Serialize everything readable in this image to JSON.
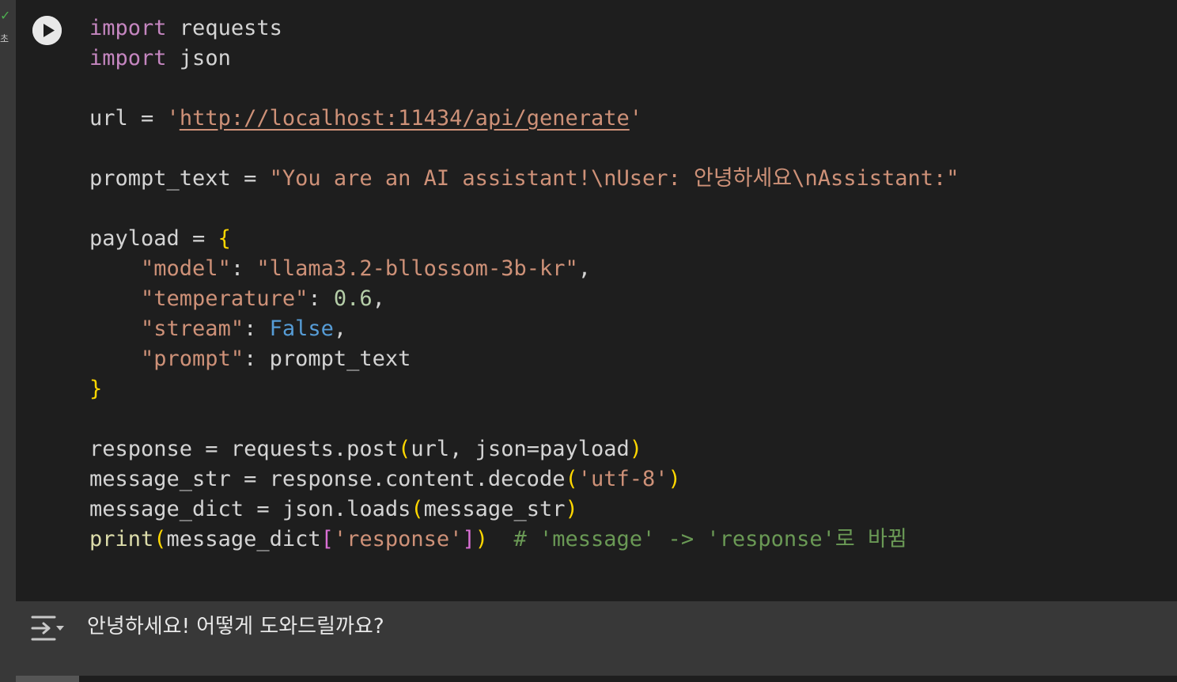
{
  "gutter": {
    "status_icon": "check-icon",
    "exec_time": "초"
  },
  "cell": {
    "run_icon": "play-icon",
    "accent_colors": {
      "keyword": "#c586c0",
      "string": "#ce9178",
      "number": "#b5cea8",
      "boolean": "#569cd6",
      "function": "#dcdcaa",
      "bracket_outer": "#ffd700",
      "bracket_inner": "#da70d6",
      "comment": "#6a9955"
    },
    "code": {
      "l1_kw": "import",
      "l1_rest": " requests",
      "l2_kw": "import",
      "l2_rest": " json",
      "l4_var": "url = ",
      "l4_q1": "'",
      "l4_url": "http://localhost:11434/api/generate",
      "l4_q2": "'",
      "l6_var": "prompt_text = ",
      "l6_str": "\"You are an AI assistant!\\nUser: 안녕하세요\\nAssistant:\"",
      "l8_var": "payload = ",
      "l8_brace": "{",
      "l9_indent": "    ",
      "l9_key": "\"model\"",
      "l9_colon": ": ",
      "l9_val": "\"llama3.2-bllossom-3b-kr\"",
      "l9_comma": ",",
      "l10_indent": "    ",
      "l10_key": "\"temperature\"",
      "l10_colon": ": ",
      "l10_val": "0.6",
      "l10_comma": ",",
      "l11_indent": "    ",
      "l11_key": "\"stream\"",
      "l11_colon": ": ",
      "l11_val": "False",
      "l11_comma": ",",
      "l12_indent": "    ",
      "l12_key": "\"prompt\"",
      "l12_colon": ": ",
      "l12_val": "prompt_text",
      "l13_brace": "}",
      "l15_a": "response = requests.post",
      "l15_p1": "(",
      "l15_b": "url, json=payload",
      "l15_p2": ")",
      "l16_a": "message_str = response.content.decode",
      "l16_p1": "(",
      "l16_str": "'utf-8'",
      "l16_p2": ")",
      "l17_a": "message_dict = json.loads",
      "l17_p1": "(",
      "l17_b": "message_str",
      "l17_p2": ")",
      "l18_fn": "print",
      "l18_p1": "(",
      "l18_b": "message_dict",
      "l18_sb1": "[",
      "l18_str": "'response'",
      "l18_sb2": "]",
      "l18_p2": ")",
      "l18_comment": "  # 'message' -> 'response'로 바뀜"
    }
  },
  "output": {
    "icon": "output-toggle-icon",
    "text": "안녕하세요! 어떻게 도와드릴까요?"
  }
}
